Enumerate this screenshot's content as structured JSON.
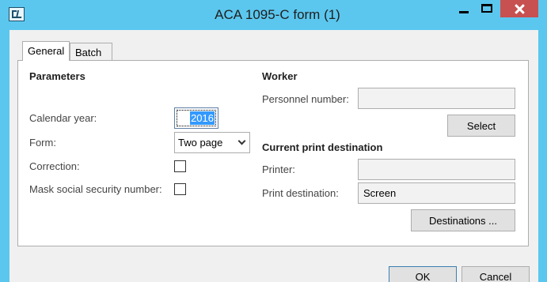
{
  "window": {
    "title": "ACA 1095-C form (1)"
  },
  "tabs": [
    {
      "label": "General",
      "active": true
    },
    {
      "label": "Batch",
      "active": false
    }
  ],
  "parameters": {
    "heading": "Parameters",
    "calendar_year_label": "Calendar year:",
    "calendar_year_value": "2016",
    "form_label": "Form:",
    "form_value": "Two page",
    "correction_label": "Correction:",
    "correction_checked": false,
    "mask_ssn_label": "Mask social security number:",
    "mask_ssn_checked": false
  },
  "worker": {
    "heading": "Worker",
    "personnel_number_label": "Personnel number:",
    "personnel_number_value": "",
    "select_button": "Select"
  },
  "print": {
    "heading": "Current print destination",
    "printer_label": "Printer:",
    "printer_value": "",
    "destination_label": "Print destination:",
    "destination_value": "Screen",
    "destinations_button": "Destinations ..."
  },
  "footer": {
    "ok_label": "OK",
    "cancel_label": "Cancel"
  },
  "colors": {
    "title_bar": "#5bc7ee",
    "close_button": "#c75050",
    "selection": "#3399ff"
  }
}
